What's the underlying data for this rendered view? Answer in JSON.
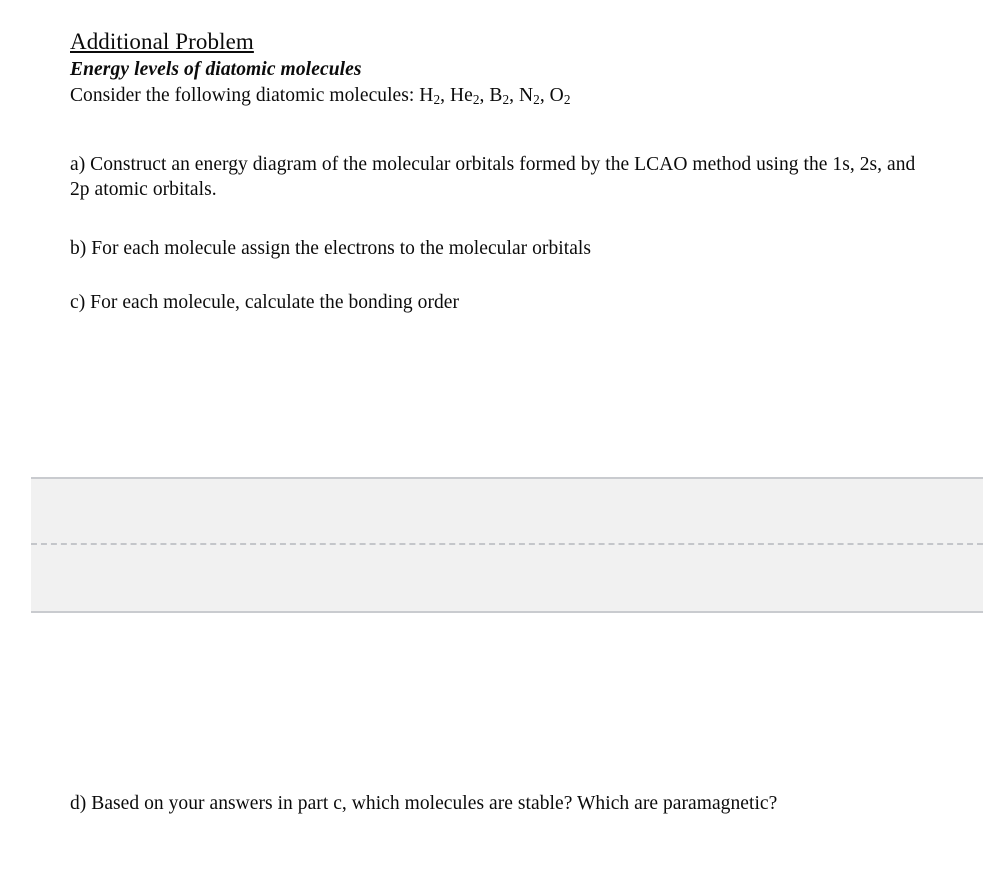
{
  "document": {
    "title": "Additional Problem",
    "subtitle": "Energy levels of diatomic molecules",
    "lead_prefix": "Consider the following diatomic molecules: ",
    "molecules": [
      "H2",
      "He2",
      "B2",
      "N2",
      "O2"
    ],
    "molecules_text": "H2, He2, B2, N2, O2",
    "parts": [
      {
        "letter": "a",
        "text": "a) Construct an energy diagram of the molecular orbitals formed by the LCAO method using the 1s, 2s, and 2p atomic orbitals."
      },
      {
        "letter": "b",
        "text": "b) For each molecule assign the electrons to the molecular orbitals"
      },
      {
        "letter": "c",
        "text": "c) For each molecule, calculate the bonding order"
      },
      {
        "letter": "d",
        "text": "d) Based on your answers in part c, which molecules are stable? Which are paramagnetic?"
      }
    ],
    "answer_panel": {
      "content": "",
      "background_color": "#f1f1f1",
      "border_color": "#c9cbcf",
      "divider_color": "#c4c6ca"
    },
    "page_background_color": "#ffffff",
    "text_color": "#0b0b0b"
  }
}
